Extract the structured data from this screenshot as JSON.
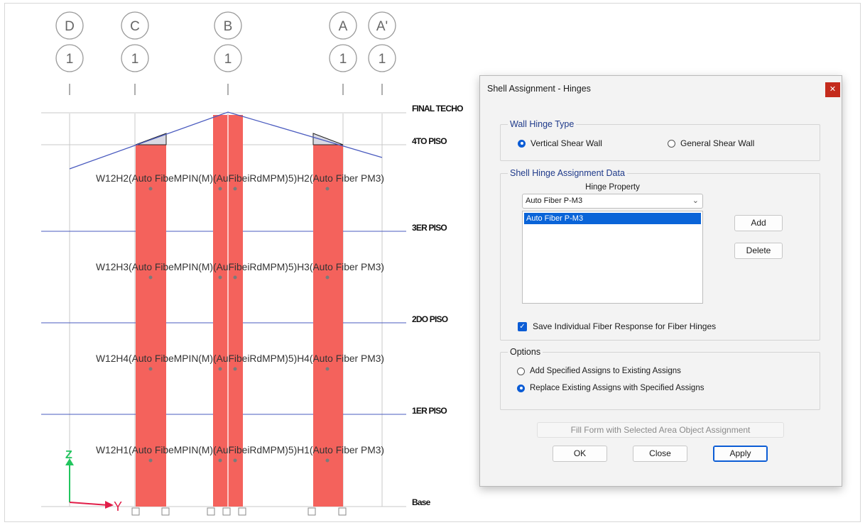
{
  "model": {
    "grid_bubbles": [
      {
        "letter": "D",
        "number": "1"
      },
      {
        "letter": "C",
        "number": "1"
      },
      {
        "letter": "B",
        "number": "1"
      },
      {
        "letter": "A",
        "number": "1"
      },
      {
        "letter": "A'",
        "number": "1"
      }
    ],
    "story_labels": [
      "FINAL TECHO",
      "4TO PISO",
      "3ER PISO",
      "2DO PISO",
      "1ER PISO",
      "Base"
    ],
    "hinge_labels": [
      "W12H2(Auto FibeMPIN(M)(AuFibeiRdMPM)5)H2(Auto Fiber PM3)",
      "W12H3(Auto FibeMPIN(M)(AuFibeiRdMPM)5)H3(Auto Fiber PM3)",
      "W12H4(Auto FibeMPIN(M)(AuFibeiRdMPM)5)H4(Auto Fiber PM3)",
      "W12H1(Auto FibeMPIN(M)(AuFibeiRdMPM)5)H1(Auto Fiber PM3)"
    ],
    "axes": {
      "z": "Z",
      "y": "Y"
    },
    "colors": {
      "wall_fill": "#f4625c",
      "story_line": "#4a5bbf",
      "grid_line": "#c8c8c8",
      "axis_z": "#22c55e",
      "axis_y": "#e11d48"
    }
  },
  "dialog": {
    "title": "Shell Assignment - Hinges",
    "close_icon": "close-icon",
    "wall_hinge_type": {
      "title": "Wall Hinge Type",
      "options": [
        "Vertical Shear Wall",
        "General Shear Wall"
      ],
      "selected": "Vertical Shear Wall"
    },
    "assignment_data": {
      "title": "Shell Hinge Assignment Data",
      "hinge_property_label": "Hinge Property",
      "dropdown_value": "Auto Fiber P-M3",
      "list_items": [
        "Auto Fiber P-M3"
      ],
      "add_label": "Add",
      "delete_label": "Delete",
      "save_fiber_label": "Save Individual Fiber Response for Fiber Hinges",
      "save_fiber_checked": true
    },
    "options": {
      "title": "Options",
      "items": [
        "Add Specified Assigns to Existing Assigns",
        "Replace Existing Assigns with Specified Assigns"
      ],
      "selected": "Replace Existing Assigns with Specified Assigns"
    },
    "fill_form_label": "Fill Form with Selected Area Object Assignment",
    "ok_label": "OK",
    "close_label": "Close",
    "apply_label": "Apply"
  }
}
